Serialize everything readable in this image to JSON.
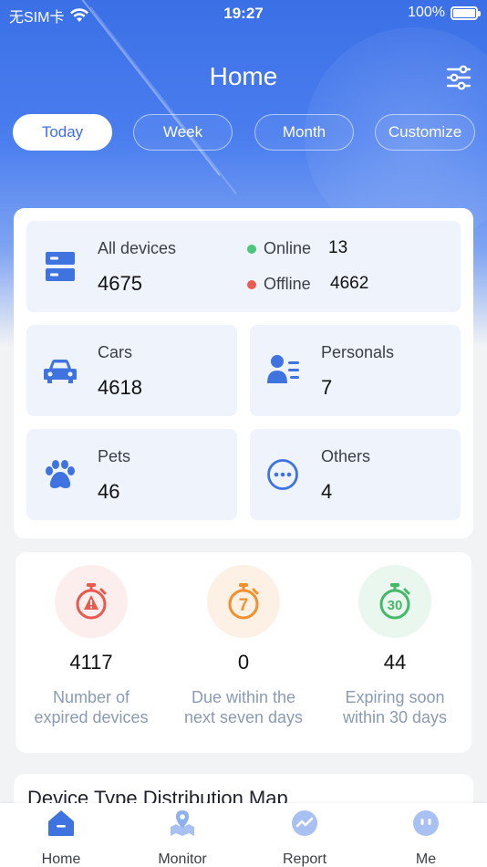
{
  "status_bar": {
    "carrier": "无SIM卡",
    "time": "19:27",
    "battery": "100%"
  },
  "header": {
    "title": "Home",
    "filter_icon": "sliders-icon"
  },
  "tabs": [
    {
      "label": "Today",
      "active": true
    },
    {
      "label": "Week",
      "active": false
    },
    {
      "label": "Month",
      "active": false
    },
    {
      "label": "Customize",
      "active": false
    }
  ],
  "devices": {
    "all_label": "All devices",
    "all_value": "4675",
    "online_label": "Online",
    "online_value": "13",
    "offline_label": "Offline",
    "offline_value": "4662",
    "online_color": "#4cc77a",
    "offline_color": "#ec5a52"
  },
  "categories": [
    {
      "label": "Cars",
      "value": "4618",
      "icon": "car-icon"
    },
    {
      "label": "Personals",
      "value": "7",
      "icon": "person-list-icon"
    },
    {
      "label": "Pets",
      "value": "46",
      "icon": "paw-icon"
    },
    {
      "label": "Others",
      "value": "4",
      "icon": "more-circle-icon"
    }
  ],
  "expiry": [
    {
      "value": "4117",
      "label_line1": "Number of",
      "label_line2": "expired devices",
      "badge": "",
      "color": "#e85a4f",
      "bg": "#fdeeee"
    },
    {
      "value": "0",
      "label_line1": "Due within the",
      "label_line2": "next seven days",
      "badge": "7",
      "color": "#f0902f",
      "bg": "#fdf1e6"
    },
    {
      "value": "44",
      "label_line1": "Expiring soon",
      "label_line2": "within 30 days",
      "badge": "30",
      "color": "#45b96a",
      "bg": "#eaf7ee"
    }
  ],
  "distribution": {
    "title": "Device Type Distribution Map"
  },
  "tabbar": [
    {
      "label": "Home",
      "icon": "home-icon",
      "active": true
    },
    {
      "label": "Monitor",
      "icon": "map-pin-icon",
      "active": false
    },
    {
      "label": "Report",
      "icon": "chart-icon",
      "active": false
    },
    {
      "label": "Me",
      "icon": "face-icon",
      "active": false
    }
  ],
  "colors": {
    "brand": "#3d6fe3",
    "icon_blue": "#3f74e0"
  }
}
